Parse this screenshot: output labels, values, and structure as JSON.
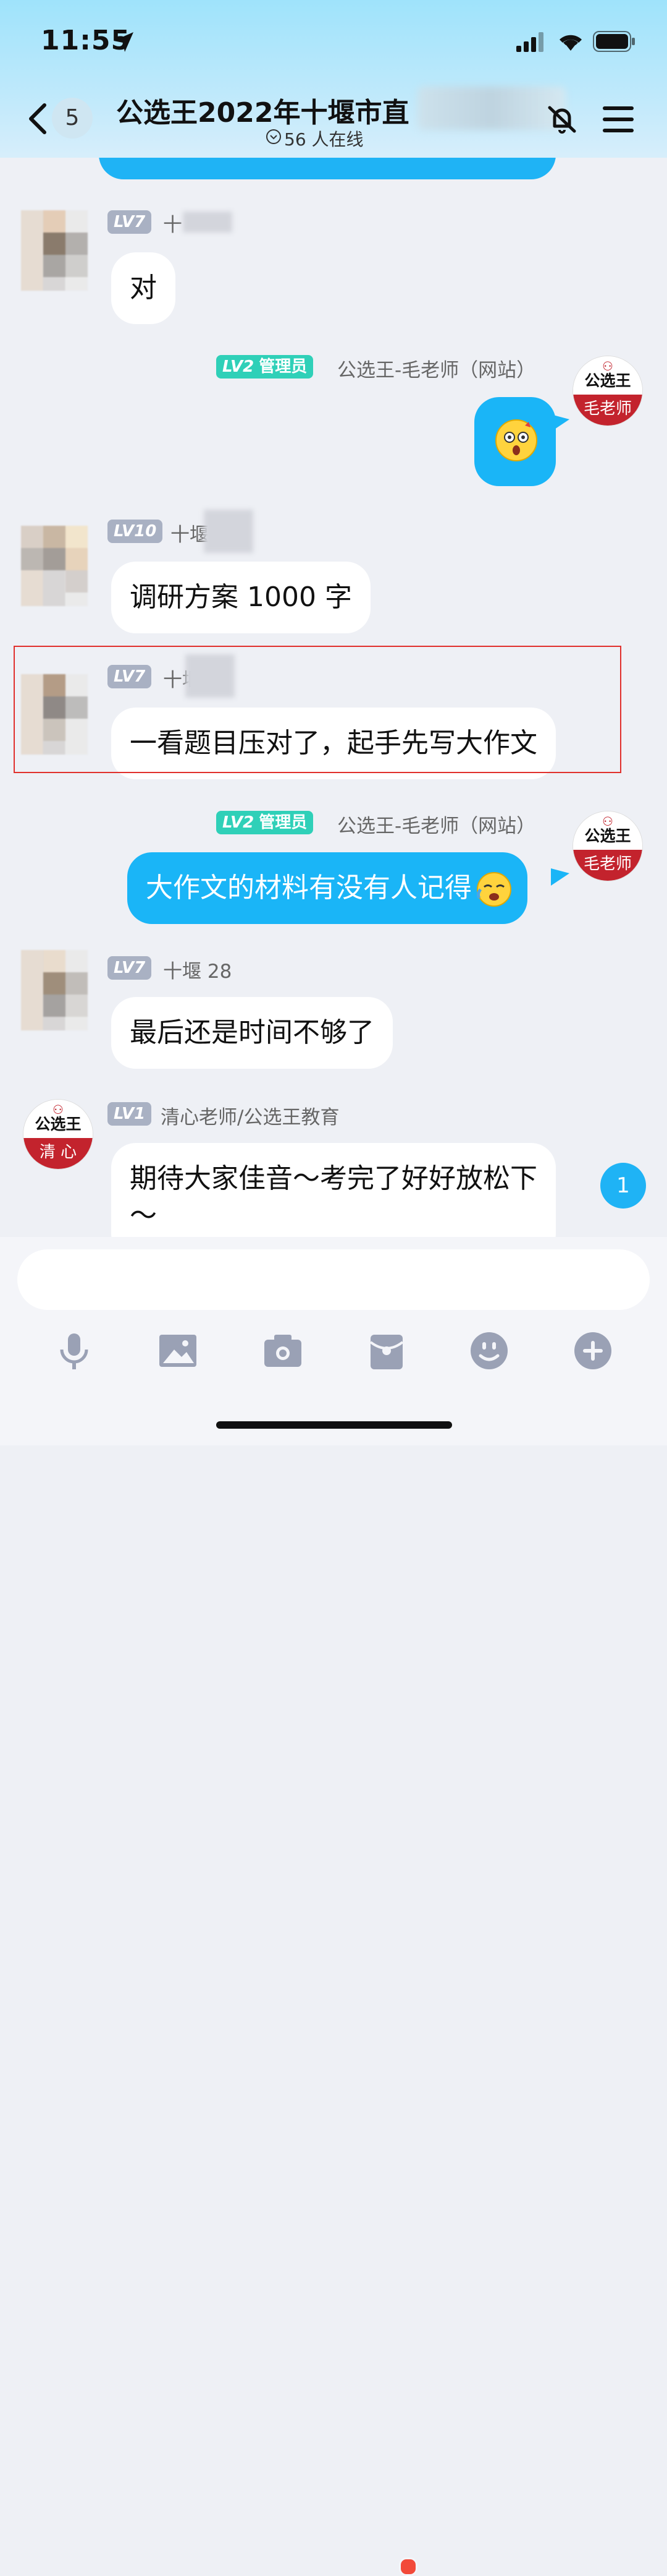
{
  "status_bar": {
    "time": "11:55"
  },
  "header": {
    "unread_count": "5",
    "title": "公选王2022年十堰市直",
    "online": "56 人在线"
  },
  "messages": [
    {
      "id": "m1",
      "level": "LV7",
      "user": "十",
      "text": "对"
    },
    {
      "id": "m2",
      "level": "LV2",
      "role": "管理员",
      "user": "公选王-毛老师（网站）",
      "text": ""
    },
    {
      "id": "m3",
      "level": "LV10",
      "user": "十堰",
      "text": "调研方案 1000 字"
    },
    {
      "id": "m4",
      "level": "LV7",
      "user": "十堰",
      "text": "一看题目压对了，起手先写大作文"
    },
    {
      "id": "m5",
      "level": "LV2",
      "role": "管理员",
      "user": "公选王-毛老师（网站）",
      "text": "大作文的材料有没有人记得"
    },
    {
      "id": "m6",
      "level": "LV7",
      "user": "十堰 28",
      "text": "最后还是时间不够了"
    },
    {
      "id": "m7",
      "level": "LV1",
      "user": "清心老师/公选王教育",
      "text_line1": "期待大家佳音～考完了好好放松下",
      "text_line2": "～"
    }
  ],
  "avatars": {
    "admin_brand": "公选王",
    "admin_name": "毛老师",
    "teacher_brand": "公选王",
    "teacher_name": "清 心"
  },
  "floating_unread": "1",
  "toolbar": [
    "mic-icon",
    "image-icon",
    "camera-icon",
    "red-packet-icon",
    "emoji-icon",
    "plus-icon"
  ],
  "colors": {
    "accent": "#1ab5f7",
    "admin_badge": "#2fd0b8",
    "level_badge": "#a9b1c3",
    "brand_red": "#c3232d"
  }
}
